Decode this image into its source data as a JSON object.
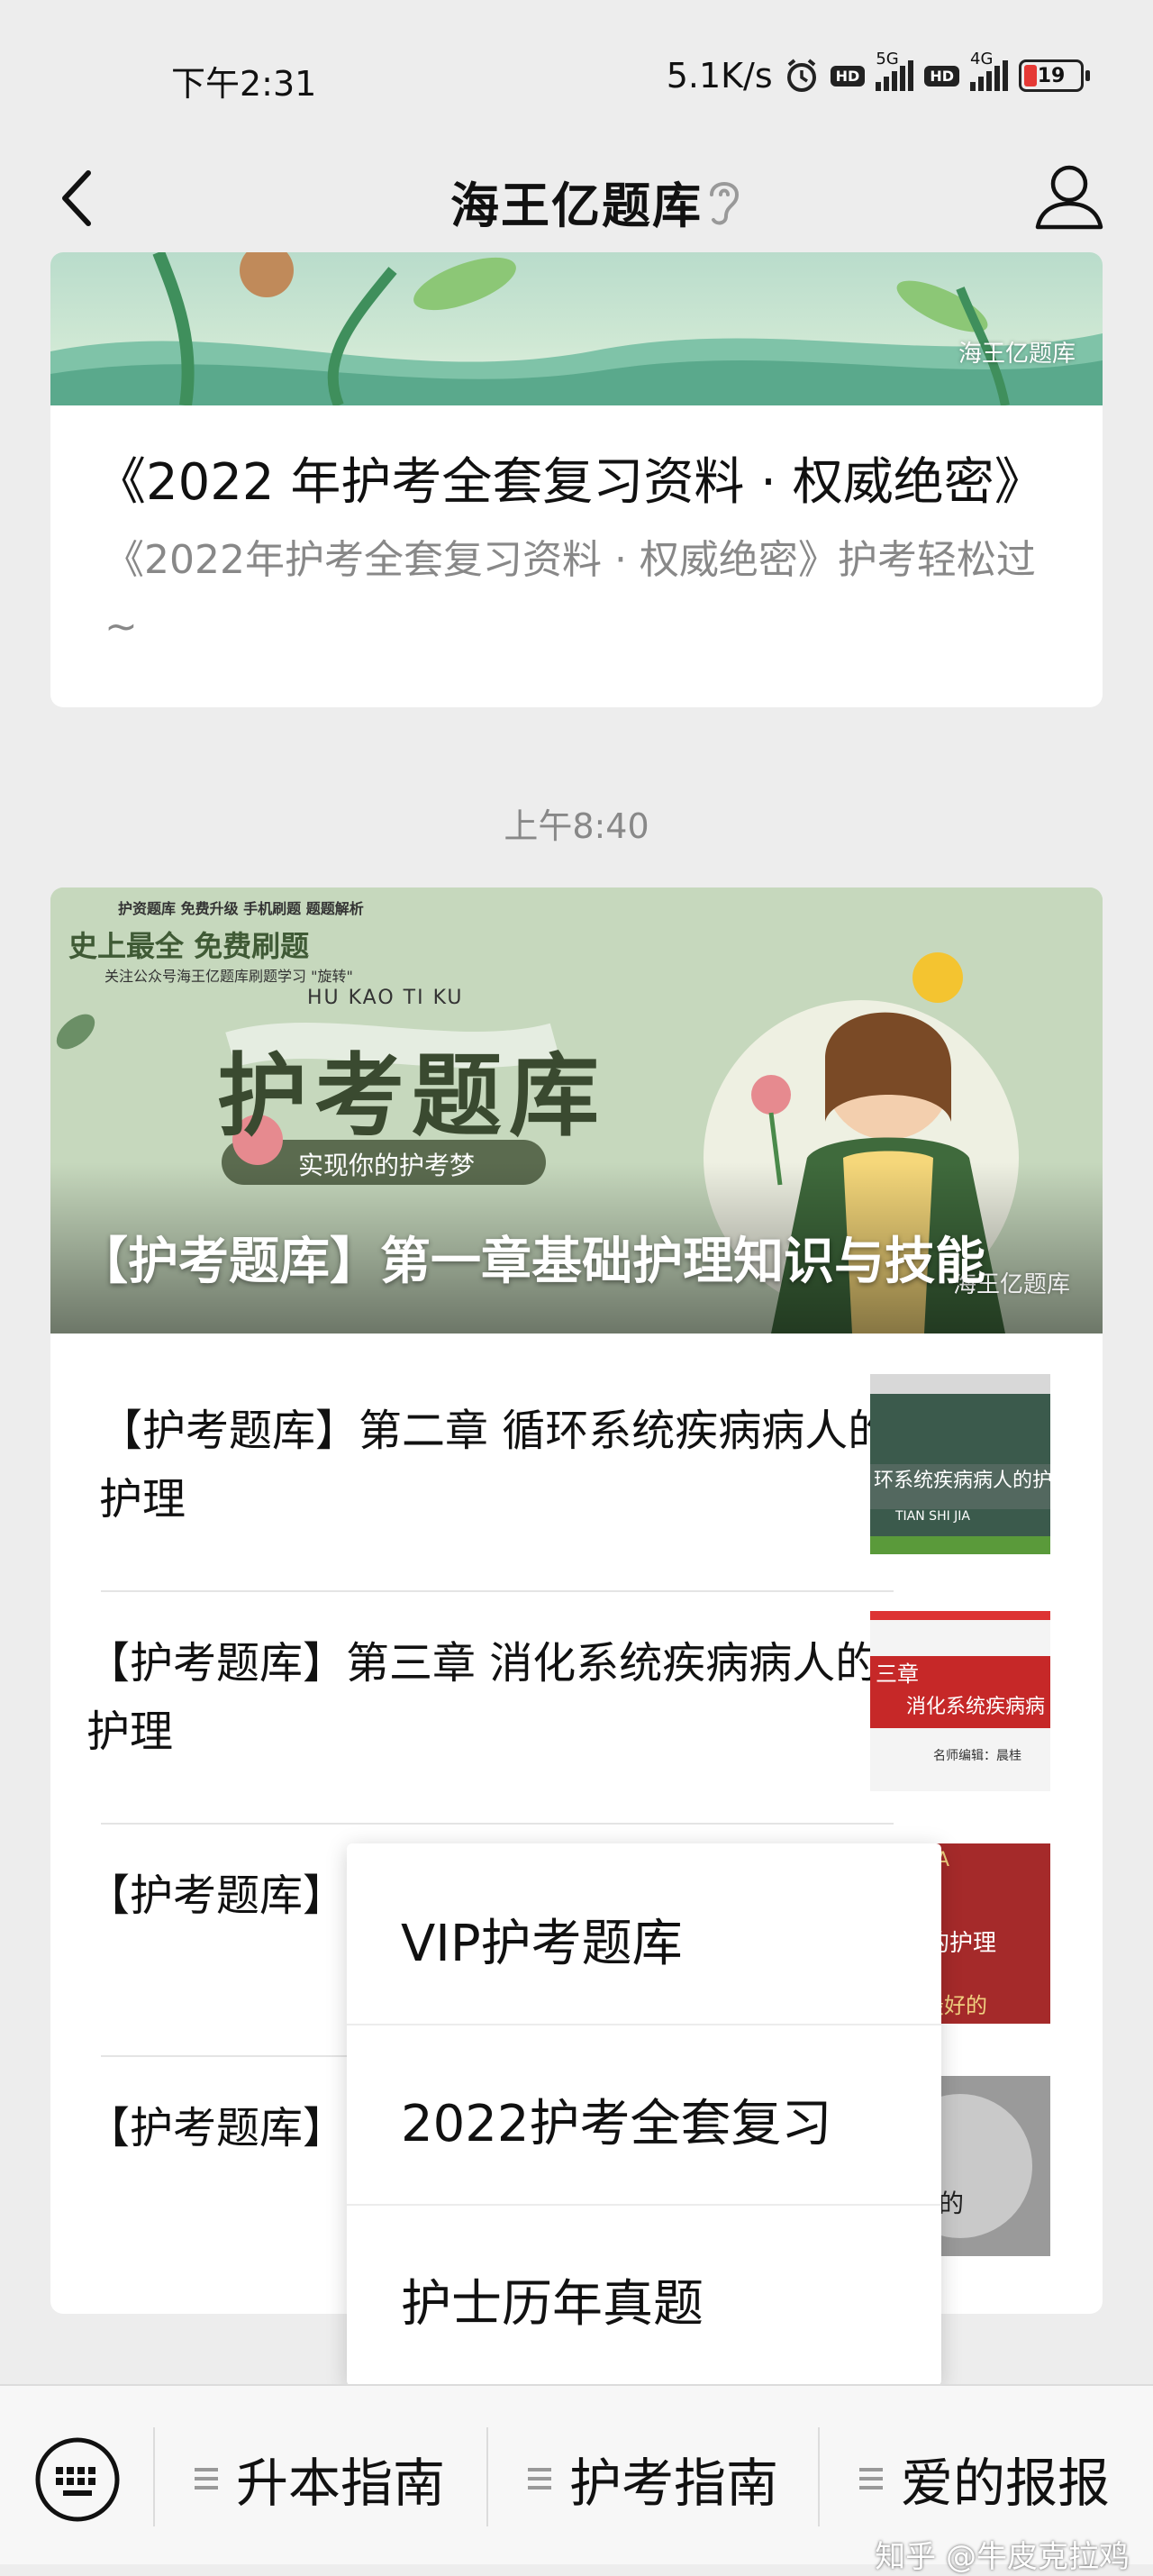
{
  "status_bar": {
    "time": "下午2:31",
    "speed": "5.1K/s",
    "hd1": "HD",
    "net1": "5G",
    "hd2": "HD",
    "net2": "4G",
    "battery": "19"
  },
  "header": {
    "title": "海王亿题库",
    "icons": [
      "back-icon",
      "ear-icon",
      "profile-icon"
    ]
  },
  "card1": {
    "watermark": "海王亿题库",
    "title": "《2022 年护考全套复习资料 · 权威绝密》",
    "description": "《2022年护考全套复习资料 · 权威绝密》护考轻松过~"
  },
  "timestamp": "上午8:40",
  "card2": {
    "hero": {
      "top_small": "护资题库 免费升级 手机刷题 题题解析",
      "slogan": "史上最全 免费刷题",
      "follow": "关注公众号海王亿题库刷题学习 \"旋转\"",
      "pinyin": "HU KAO TI KU",
      "big_title": "护考题库",
      "ribbon": "实现你的护考梦",
      "watermark": "海王亿题库",
      "title": "【护考题库】第一章基础护理知识与技能"
    },
    "articles": [
      {
        "title": "【护考题库】第二章  循环系统疾病病人的护理",
        "thumb_text": "环系统疾病病人的护理",
        "thumb_sub": "TIAN SHI JIA"
      },
      {
        "title": "【护考题库】第三章 消化系统疾病病人的护理",
        "thumb_text": "消化系统疾病病",
        "thumb_head": "三章",
        "thumb_sub": "名师编辑：晨桂"
      },
      {
        "title": "【护考题库】第人的护理",
        "thumb_text": "病人的护理",
        "thumb_head": "JIA",
        "thumb_sub": "给你最好的"
      },
      {
        "title": "【护考题库】第理",
        "thumb_text": "病人的"
      }
    ]
  },
  "popup_menu": {
    "items": [
      "VIP护考题库",
      "2022护考全套复习",
      "护士历年真题"
    ]
  },
  "bottom_bar": {
    "menus": [
      "升本指南",
      "护考指南",
      "爱的报报"
    ]
  },
  "watermark": "知乎 @牛皮克拉鸡",
  "colors": {
    "background": "#ededed",
    "card": "#ffffff",
    "muted_text": "#888888",
    "battery_low": "#e53935"
  }
}
